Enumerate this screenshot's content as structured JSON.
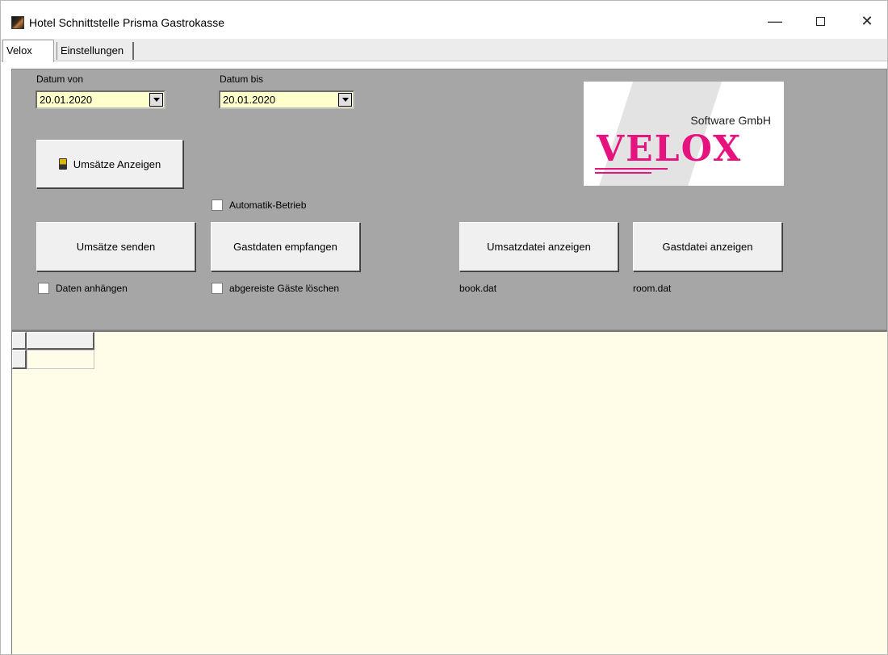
{
  "window": {
    "title": "Hotel Schnittstelle Prisma Gastrokasse",
    "minimize_glyph": "—",
    "close_glyph": "✕"
  },
  "tabs": [
    {
      "label": "Velox",
      "active": true
    },
    {
      "label": "Einstellungen",
      "active": false
    }
  ],
  "filters": {
    "date_from_label": "Datum von",
    "date_from_value": "20.01.2020",
    "date_to_label": "Datum bis",
    "date_to_value": "20.01.2020"
  },
  "buttons": {
    "show_sales": "Umsätze Anzeigen",
    "send_sales": "Umsätze senden",
    "receive_guests": "Gastdaten empfangen",
    "show_sales_file": "Umsatzdatei anzeigen",
    "show_guest_file": "Gastdatei anzeigen"
  },
  "checkboxes": {
    "auto_mode": {
      "label": "Automatik-Betrieb",
      "checked": false
    },
    "append_data": {
      "label": "Daten anhängen",
      "checked": false
    },
    "delete_departed": {
      "label": "abgereiste Gäste löschen",
      "checked": false
    }
  },
  "files": {
    "sales_file": "book.dat",
    "guest_file": "room.dat"
  },
  "logo": {
    "company": "Software GmbH",
    "brand": "VELOX",
    "brand_color": "#e6137f"
  },
  "colors": {
    "panel_bg": "#a6a6a6",
    "grid_bg": "#fffde7",
    "combo_bg": "#ffffcc"
  }
}
